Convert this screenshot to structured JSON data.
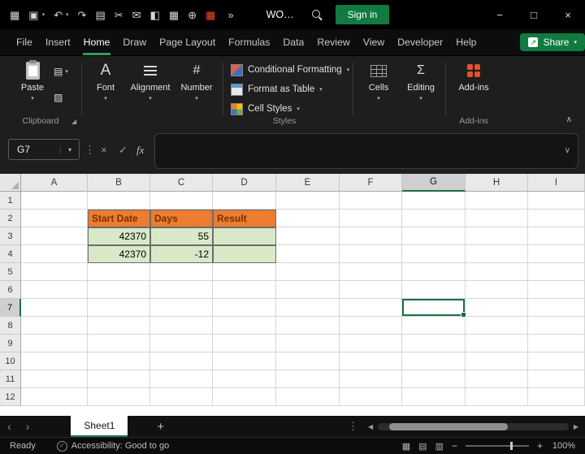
{
  "titlebar": {
    "qat": [
      {
        "name": "apps-grid-icon",
        "glyph": "▦"
      },
      {
        "name": "save-icon",
        "glyph": "▣"
      },
      {
        "name": "undo-icon",
        "glyph": "↶"
      },
      {
        "name": "redo-icon",
        "glyph": "↷"
      },
      {
        "name": "copy-icon",
        "glyph": "▤"
      },
      {
        "name": "cut-icon",
        "glyph": "✂"
      },
      {
        "name": "mail-icon",
        "glyph": "✉"
      },
      {
        "name": "format-painter-icon",
        "glyph": "◧"
      },
      {
        "name": "table-icon",
        "glyph": "▦"
      },
      {
        "name": "add-icon",
        "glyph": "⊕"
      },
      {
        "name": "addins-icon",
        "glyph": "▦"
      }
    ],
    "overflow": "»",
    "doc_title": "WO…",
    "sign_in": "Sign in",
    "window": {
      "minimize": "−",
      "maximize": "□",
      "close": "×"
    }
  },
  "menubar": {
    "items": [
      "File",
      "Insert",
      "Home",
      "Draw",
      "Page Layout",
      "Formulas",
      "Data",
      "Review",
      "View",
      "Developer",
      "Help"
    ],
    "active": "Home",
    "share": {
      "label": "Share"
    }
  },
  "ribbon": {
    "paste": {
      "label": "Paste"
    },
    "groups": {
      "clipboard": "Clipboard",
      "styles": "Styles",
      "addins": "Add-ins"
    },
    "font": {
      "label": "Font"
    },
    "alignment": {
      "label": "Alignment"
    },
    "number": {
      "label": "Number"
    },
    "styles_items": [
      {
        "label": "Conditional Formatting"
      },
      {
        "label": "Format as Table"
      },
      {
        "label": "Cell Styles"
      }
    ],
    "cells": {
      "label": "Cells"
    },
    "editing": {
      "label": "Editing"
    },
    "addins": {
      "label": "Add-ins"
    }
  },
  "formula_bar": {
    "name_box": "G7",
    "fx": "fx",
    "formula": ""
  },
  "sheet": {
    "col_headers": [
      "A",
      "B",
      "C",
      "D",
      "E",
      "F",
      "G",
      "H",
      "I"
    ],
    "row_headers": [
      "1",
      "2",
      "3",
      "4",
      "5",
      "6",
      "7",
      "8",
      "9",
      "10",
      "11",
      "12"
    ],
    "selected": {
      "ref": "G7",
      "col": "G",
      "row": "7"
    },
    "cells": [
      {
        "ref": "B2",
        "text": "Start Date",
        "style": "hdr"
      },
      {
        "ref": "C2",
        "text": "Days",
        "style": "hdr"
      },
      {
        "ref": "D2",
        "text": "Result",
        "style": "hdr"
      },
      {
        "ref": "B3",
        "text": "42370",
        "style": "num"
      },
      {
        "ref": "C3",
        "text": "55",
        "style": "num"
      },
      {
        "ref": "D3",
        "text": "",
        "style": "green"
      },
      {
        "ref": "B4",
        "text": "42370",
        "style": "num"
      },
      {
        "ref": "C4",
        "text": "-12",
        "style": "num"
      },
      {
        "ref": "D4",
        "text": "",
        "style": "green"
      }
    ],
    "colors": {
      "header_fill": "#EC7C2F",
      "header_text": "#7B2F00",
      "data_fill": "#D8E9C8",
      "selection": "#1E6F42"
    }
  },
  "tabbar": {
    "sheet": "Sheet1",
    "add": "+"
  },
  "statusbar": {
    "ready": "Ready",
    "accessibility": "Accessibility: Good to go",
    "zoom": "100%"
  }
}
